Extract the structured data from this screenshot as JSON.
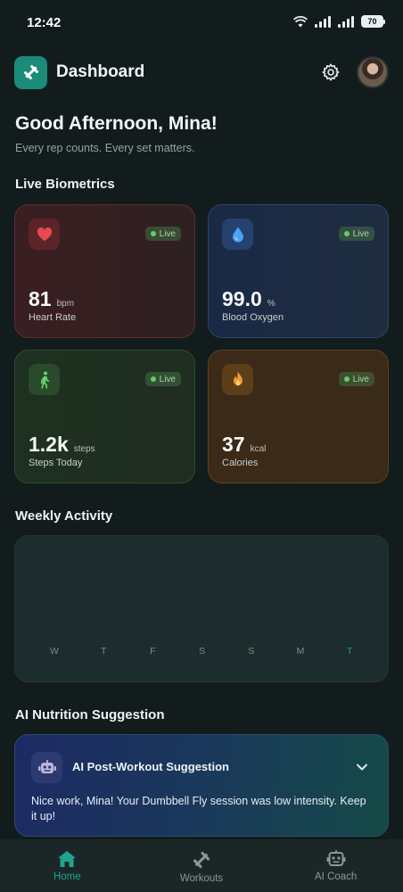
{
  "status_bar": {
    "time": "12:42",
    "battery": "70"
  },
  "header": {
    "title": "Dashboard",
    "logo_icon": "dumbbell-icon",
    "settings_icon": "gear-icon"
  },
  "greeting": {
    "title": "Good Afternoon, Mina!",
    "subtitle": "Every rep counts. Every set matters."
  },
  "biometrics": {
    "section_title": "Live Biometrics",
    "cards": [
      {
        "icon": "heart-icon",
        "badge": "Live",
        "value": "81",
        "unit": "bpm",
        "label": "Heart Rate"
      },
      {
        "icon": "water-drop-icon",
        "badge": "Live",
        "value": "99.0",
        "unit": "%",
        "label": "Blood Oxygen"
      },
      {
        "icon": "walking-icon",
        "badge": "Live",
        "value": "1.2k",
        "unit": "steps",
        "label": "Steps Today"
      },
      {
        "icon": "flame-icon",
        "badge": "Live",
        "value": "37",
        "unit": "kcal",
        "label": "Calories"
      }
    ]
  },
  "weekly": {
    "section_title": "Weekly Activity",
    "days": [
      "W",
      "T",
      "F",
      "S",
      "S",
      "M",
      "T"
    ],
    "active_index": 6,
    "accent": "#1f9e88"
  },
  "nutrition": {
    "section_title": "AI Nutrition Suggestion",
    "card_title": "AI Post-Workout Suggestion",
    "message": "Nice work, Mina! Your Dumbbell Fly session was low intensity. Keep it up!"
  },
  "bottom_nav": {
    "items": [
      {
        "label": "Home",
        "icon": "home-icon",
        "active": true
      },
      {
        "label": "Workouts",
        "icon": "dumbbell-icon",
        "active": false
      },
      {
        "label": "AI Coach",
        "icon": "robot-icon",
        "active": false
      }
    ]
  }
}
